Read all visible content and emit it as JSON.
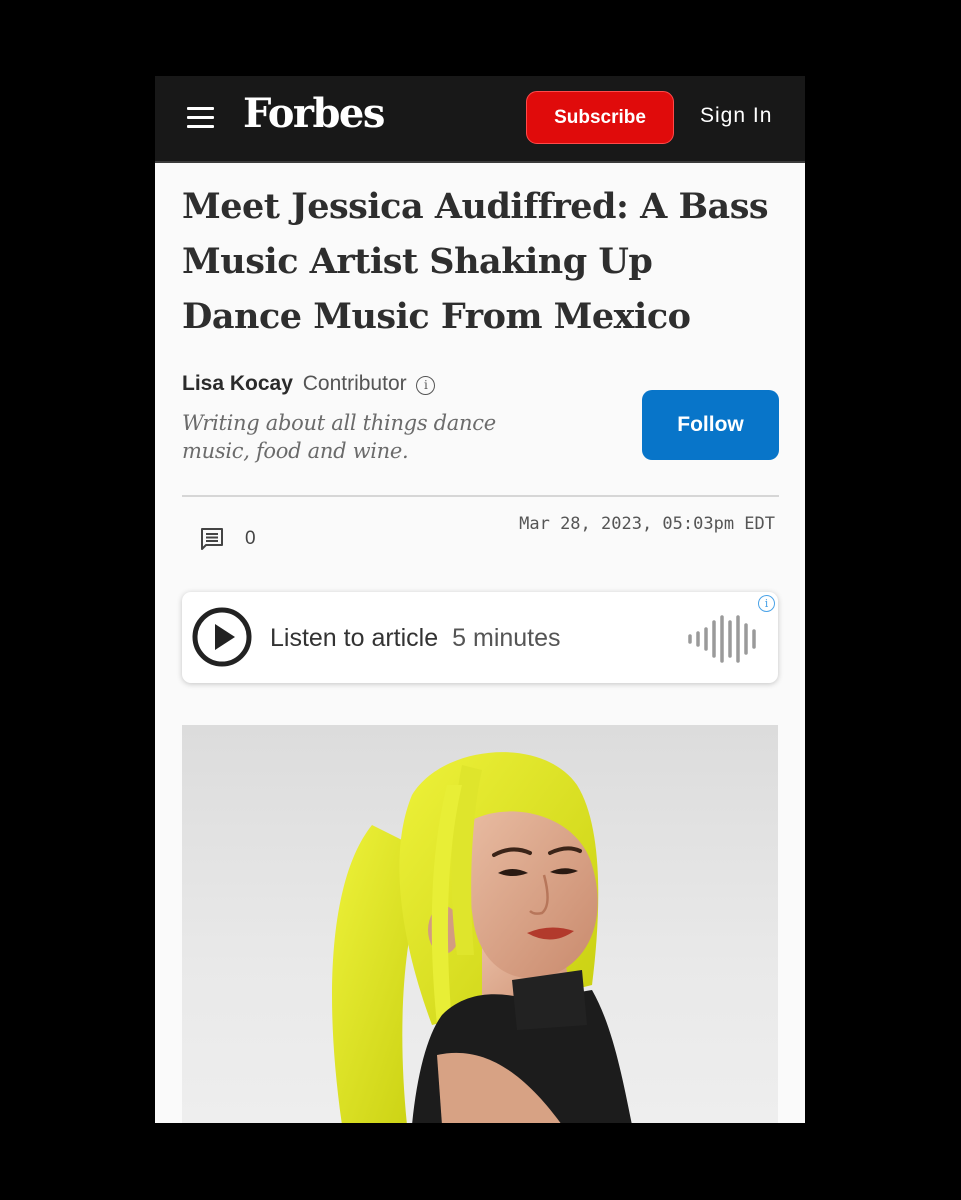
{
  "topbar": {
    "logo": "Forbes",
    "subscribe_label": "Subscribe",
    "signin_label": "Sign In"
  },
  "article": {
    "headline": "Meet Jessica Audiffred: A Bass Music Artist Shaking Up Dance Music From Mexico",
    "author_name": "Lisa Kocay",
    "author_role": "Contributor",
    "author_bio": "Writing about all things dance music, food and wine.",
    "follow_label": "Follow",
    "comment_count": "0",
    "date": "Mar 28, 2023, 05:03pm EDT"
  },
  "audio": {
    "label": "Listen to article",
    "duration": "5 minutes"
  },
  "colors": {
    "brand_red": "#e00b0b",
    "follow_blue": "#0875c9",
    "topbar_bg": "#181818"
  }
}
